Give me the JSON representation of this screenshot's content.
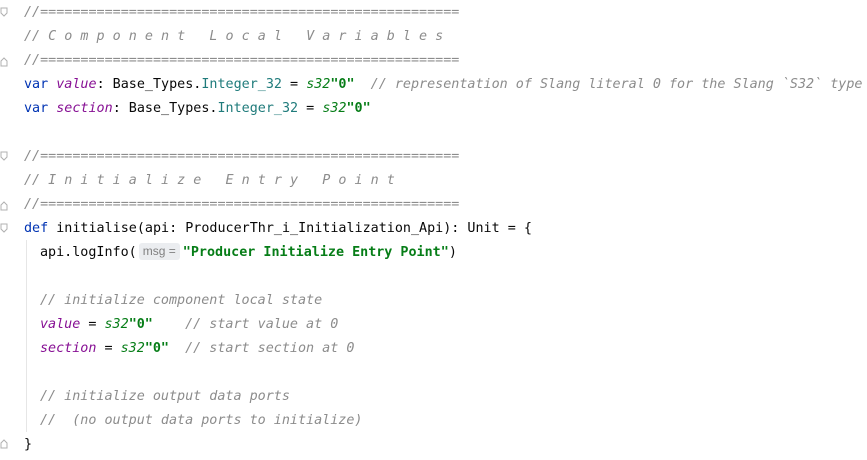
{
  "code": {
    "l1": "//====================================================",
    "l2": "// C o m p o n e n t   L o c a l   V a r i a b l e s",
    "l3": "//====================================================",
    "l4": {
      "kw": "var",
      "name": "value",
      "colon": ": Base_Types.",
      "type": "Integer_32",
      "eq": " = ",
      "prefix": "s32",
      "lit": "\"0\"",
      "comment": "  // representation of Slang literal 0 for the Slang `S32` type"
    },
    "l5": {
      "kw": "var",
      "name": "section",
      "colon": ": Base_Types.",
      "type": "Integer_32",
      "eq": " = ",
      "prefix": "s32",
      "lit": "\"0\""
    },
    "l7": "//====================================================",
    "l8": "// I n i t i a l i z e   E n t r y   P o i n t",
    "l9": "//====================================================",
    "l10": {
      "kw": "def",
      "sig": " initialise(api: ProducerThr_i_Initialization_Api): Unit = {"
    },
    "l11": {
      "call": "api.logInfo(",
      "hint": "msg =",
      "str": "\"Producer Initialize Entry Point\"",
      "close": ")"
    },
    "l13": "// initialize component local state",
    "l14": {
      "name": "value",
      "eq": " = ",
      "prefix": "s32",
      "lit": "\"0\"",
      "comment": "    // start value at 0"
    },
    "l15": {
      "name": "section",
      "eq": " = ",
      "prefix": "s32",
      "lit": "\"0\"",
      "comment": "  // start section at 0"
    },
    "l17": "// initialize output data ports",
    "l18": "//  (no output data ports to initialize)",
    "l19": "}"
  }
}
